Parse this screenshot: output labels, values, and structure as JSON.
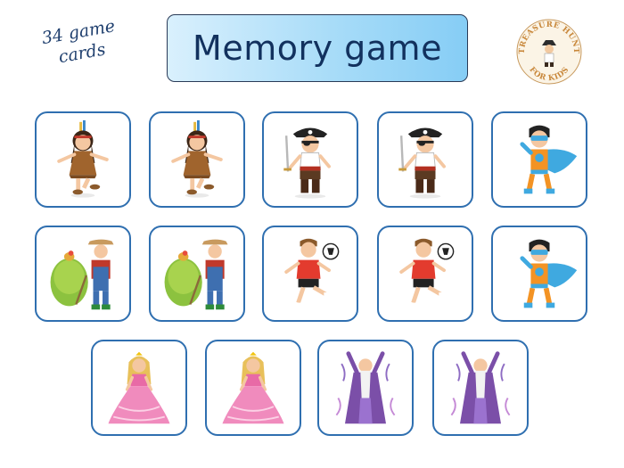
{
  "count_label": {
    "line1": "34 game",
    "line2": "cards"
  },
  "title": "Memory game",
  "logo": {
    "top": "TREASURE HUNT",
    "bottom": "FOR KIDS"
  },
  "cards": [
    {
      "character": "native-girl"
    },
    {
      "character": "native-girl"
    },
    {
      "character": "pirate"
    },
    {
      "character": "pirate"
    },
    {
      "character": "superhero"
    },
    {
      "character": "farmer"
    },
    {
      "character": "farmer"
    },
    {
      "character": "soccer-player"
    },
    {
      "character": "soccer-player"
    },
    {
      "character": "superhero"
    },
    {
      "character": "princess"
    },
    {
      "character": "princess"
    },
    {
      "character": "wizard"
    },
    {
      "character": "wizard"
    }
  ],
  "colors": {
    "card_border": "#2f6fb0",
    "title_text": "#12315e"
  }
}
